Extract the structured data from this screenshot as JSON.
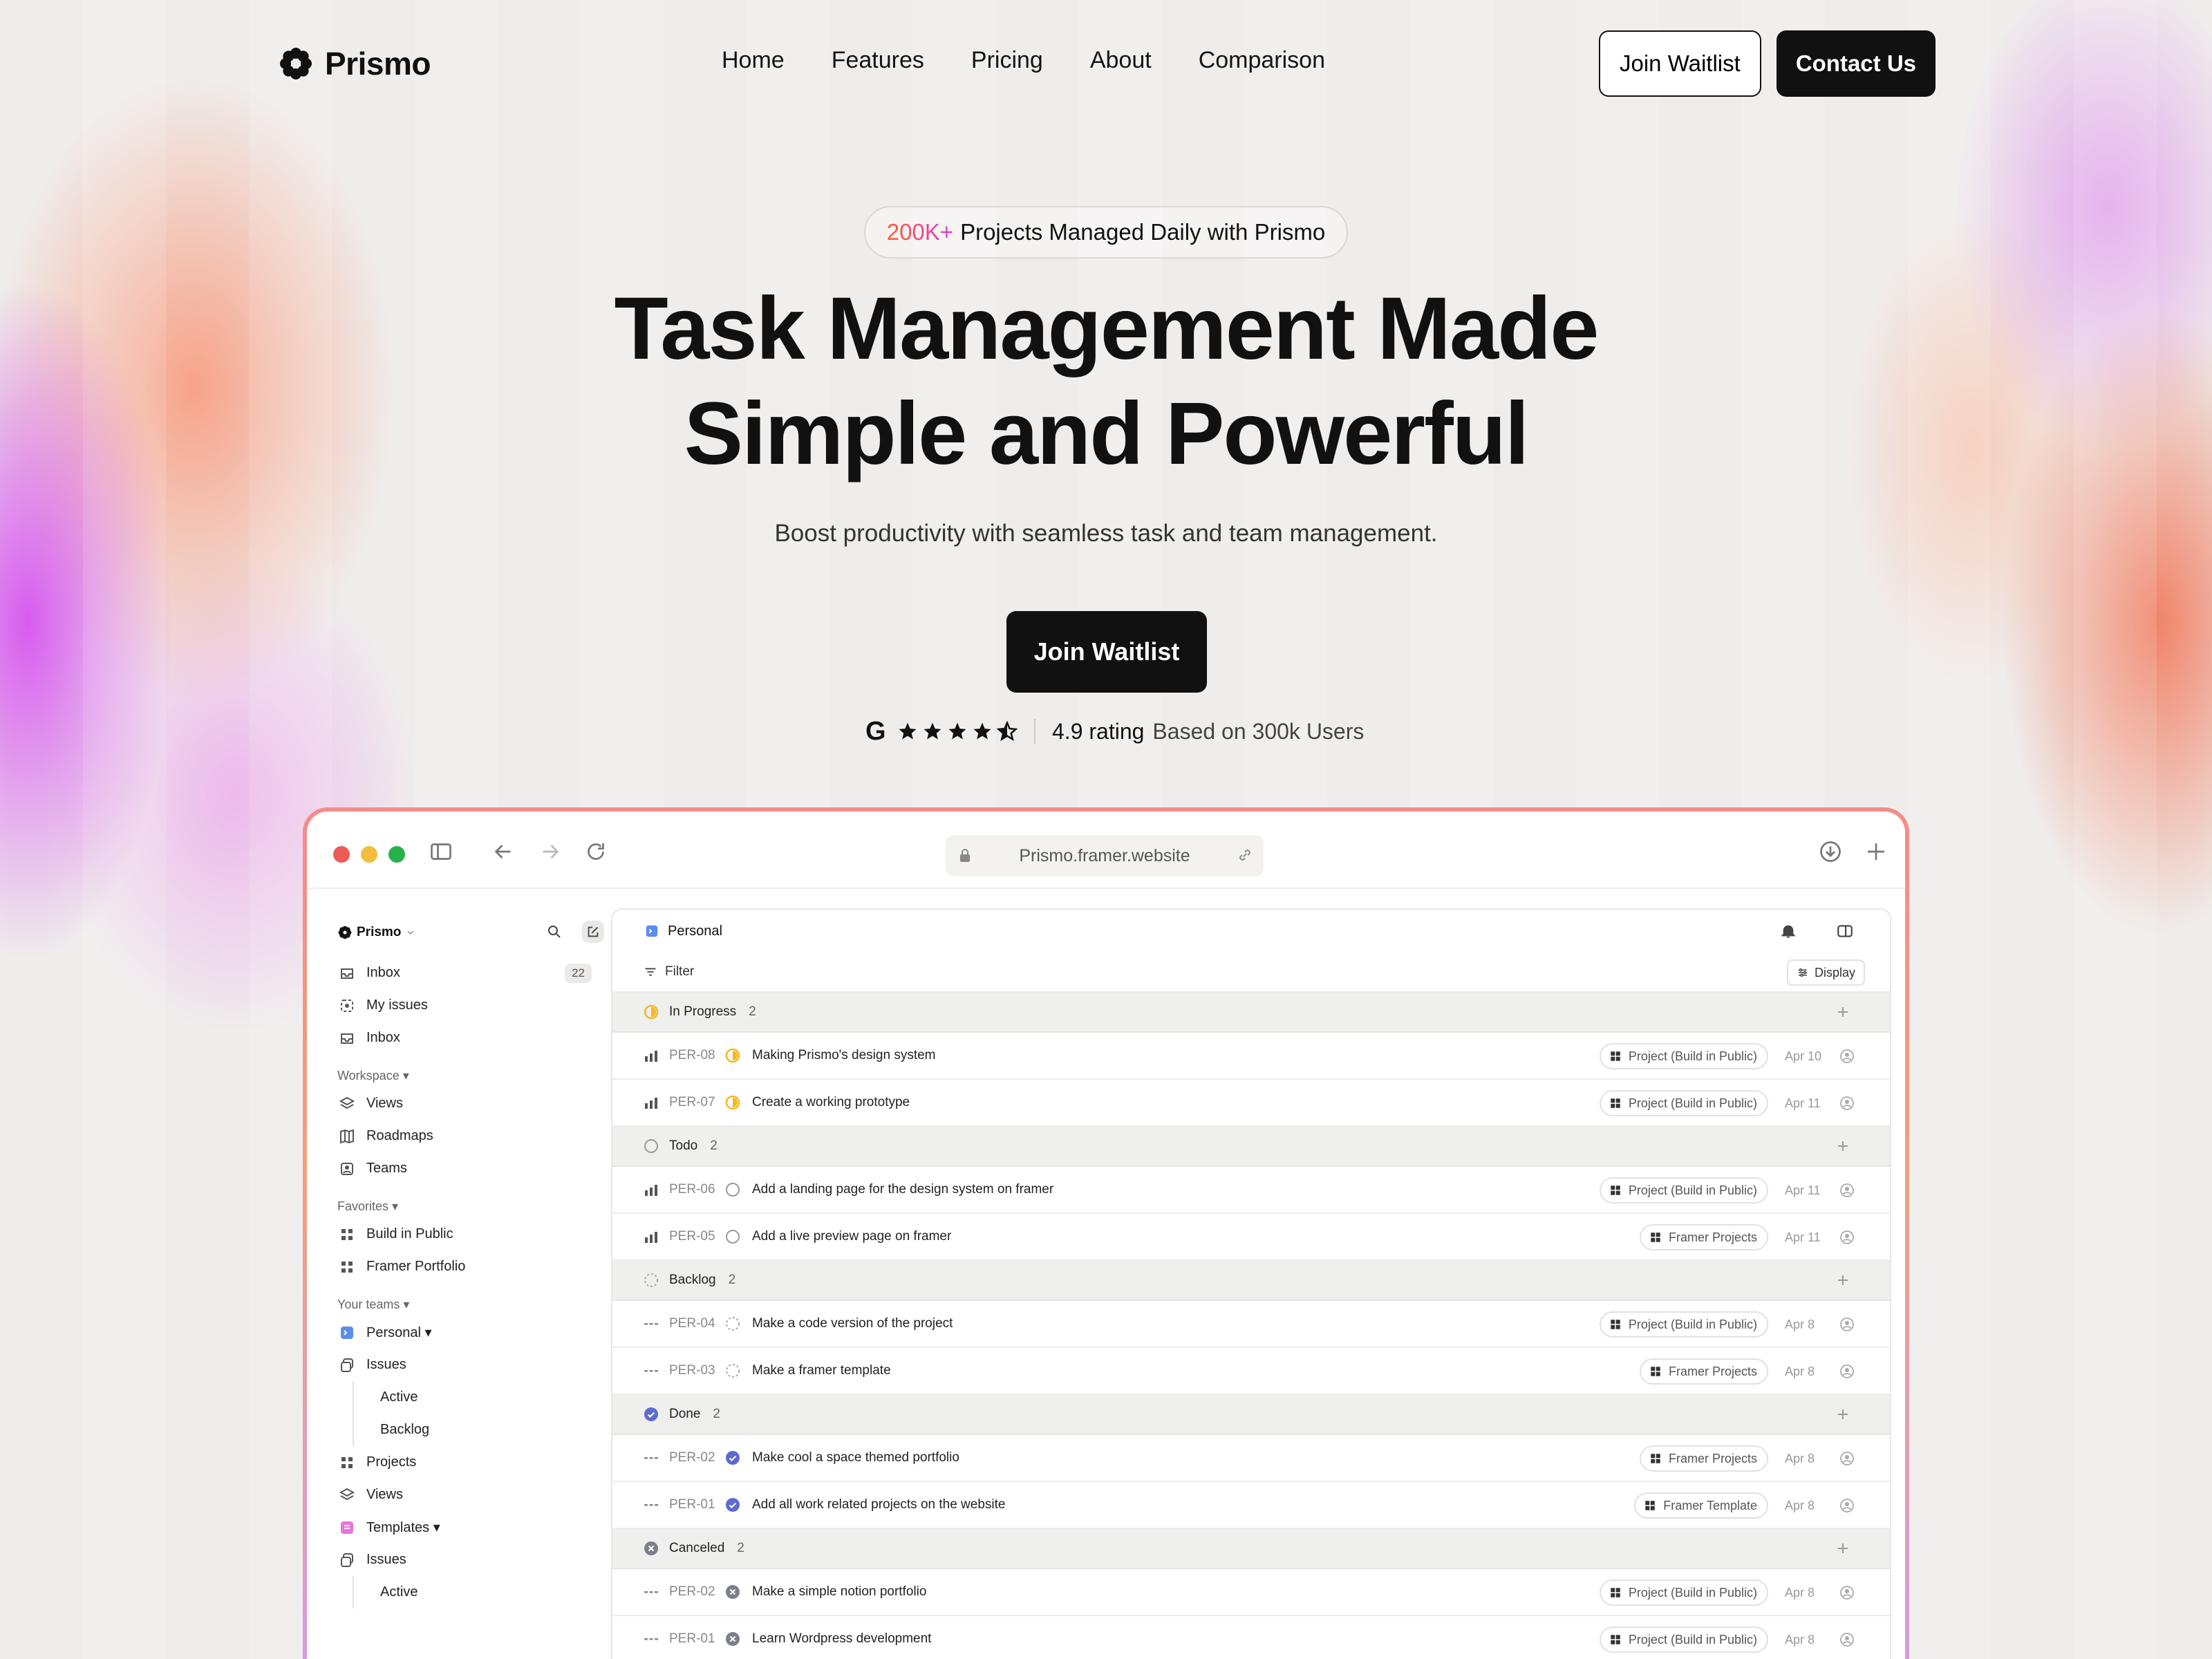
{
  "brand": {
    "name": "Prismo"
  },
  "nav": {
    "links": [
      "Home",
      "Features",
      "Pricing",
      "About",
      "Comparison"
    ],
    "join_waitlist": "Join Waitlist",
    "contact": "Contact Us"
  },
  "hero": {
    "pill_highlight": "200K+",
    "pill_text": "Projects Managed Daily with Prismo",
    "title_line1": "Task Management Made",
    "title_line2": "Simple and Powerful",
    "subtitle": "Boost productivity with seamless task and team management.",
    "cta": "Join Waitlist",
    "rating_value": "4.9 rating",
    "rating_suffix": "Based on 300k Users",
    "stars": 4.5,
    "google_icon": "G"
  },
  "browser": {
    "url": "Prismo.framer.website",
    "traffic_colors": [
      "#ee5a55",
      "#f5bd3e",
      "#27b14a"
    ]
  },
  "app": {
    "workspace_name": "Prismo",
    "sidebar": {
      "top_items": [
        {
          "label": "Inbox",
          "icon": "inbox-icon",
          "badge": "22"
        },
        {
          "label": "My issues",
          "icon": "my-issues-icon"
        },
        {
          "label": "Inbox",
          "icon": "inbox-icon"
        }
      ],
      "workspace_label": "Workspace ▾",
      "workspace_items": [
        {
          "label": "Views",
          "icon": "layers-icon"
        },
        {
          "label": "Roadmaps",
          "icon": "map-icon"
        },
        {
          "label": "Teams",
          "icon": "team-icon"
        }
      ],
      "favorites_label": "Favorites ▾",
      "favorites_items": [
        {
          "label": "Build in Public",
          "icon": "grid-icon"
        },
        {
          "label": "Framer Portfolio",
          "icon": "grid-icon"
        }
      ],
      "teams_label": "Your teams ▾",
      "personal": "Personal ▾",
      "personal_issues": "Issues",
      "personal_active": "Active",
      "personal_backlog": "Backlog",
      "personal_projects": "Projects",
      "personal_views": "Views",
      "templates": "Templates ▾",
      "templates_issues": "Issues",
      "templates_active": "Active"
    },
    "main": {
      "team": "Personal",
      "filter": "Filter",
      "display": "Display",
      "groups": [
        {
          "name": "In Progress",
          "count": "2",
          "status": "in-progress",
          "tasks": [
            {
              "id": "PER-08",
              "title": "Making Prismo's design system",
              "project": "Project (Build in Public)",
              "date": "Apr 10",
              "prio": "bars"
            },
            {
              "id": "PER-07",
              "title": "Create a working prototype",
              "project": "Project (Build in Public)",
              "date": "Apr 11",
              "prio": "bars"
            }
          ]
        },
        {
          "name": "Todo",
          "count": "2",
          "status": "todo",
          "tasks": [
            {
              "id": "PER-06",
              "title": "Add a landing page for the design system on framer",
              "project": "Project (Build in Public)",
              "date": "Apr 11",
              "prio": "bars"
            },
            {
              "id": "PER-05",
              "title": "Add a live preview page on framer",
              "project": "Framer Projects",
              "date": "Apr 11",
              "prio": "bars"
            }
          ]
        },
        {
          "name": "Backlog",
          "count": "2",
          "status": "backlog",
          "tasks": [
            {
              "id": "PER-04",
              "title": "Make a code version of the project",
              "project": "Project (Build in Public)",
              "date": "Apr 8",
              "prio": "dashes"
            },
            {
              "id": "PER-03",
              "title": "Make a framer template",
              "project": "Framer Projects",
              "date": "Apr 8",
              "prio": "dashes"
            }
          ]
        },
        {
          "name": "Done",
          "count": "2",
          "status": "done",
          "tasks": [
            {
              "id": "PER-02",
              "title": "Make cool a space themed portfolio",
              "project": "Framer Projects",
              "date": "Apr 8",
              "prio": "dashes"
            },
            {
              "id": "PER-01",
              "title": "Add all work related projects on the website",
              "project": "Framer Template",
              "date": "Apr 8",
              "prio": "dashes"
            }
          ]
        },
        {
          "name": "Canceled",
          "count": "2",
          "status": "canceled",
          "tasks": [
            {
              "id": "PER-02",
              "title": "Make a simple notion portfolio",
              "project": "Project (Build in Public)",
              "date": "Apr 8",
              "prio": "dashes"
            },
            {
              "id": "PER-01",
              "title": "Learn Wordpress development",
              "project": "Project (Build in Public)",
              "date": "Apr 8",
              "prio": "dashes"
            }
          ]
        }
      ]
    }
  }
}
